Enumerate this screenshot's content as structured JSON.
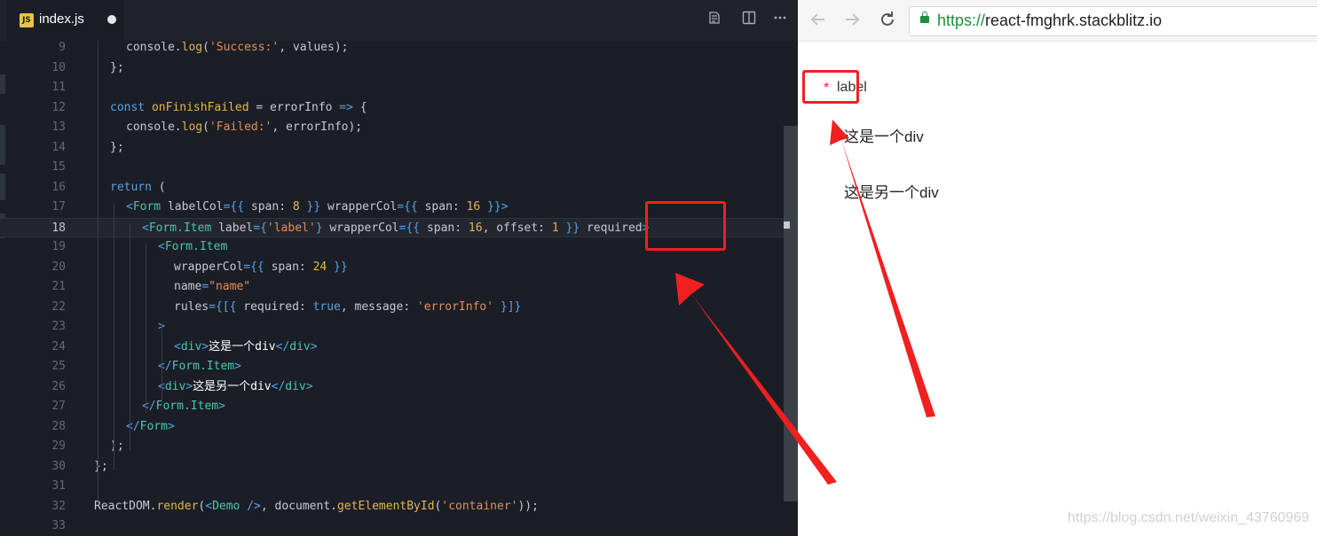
{
  "editor": {
    "tab": {
      "icon_text": "JS",
      "filename": "index.js"
    },
    "toolbar_icons": [
      "preview-icon",
      "split-editor-icon",
      "more-icon"
    ],
    "lines": [
      {
        "n": "9",
        "tokens": [
          [
            "attr",
            "console"
          ],
          [
            "attr",
            "."
          ],
          [
            "fn",
            "log"
          ],
          [
            "attr",
            "("
          ],
          [
            "str",
            "'Success:'"
          ],
          [
            "attr",
            ", values);"
          ]
        ]
      },
      {
        "n": "10",
        "tokens": [
          [
            "attr",
            "};"
          ]
        ]
      },
      {
        "n": "11",
        "tokens": []
      },
      {
        "n": "12",
        "tokens": [
          [
            "kw",
            "const "
          ],
          [
            "fn",
            "onFinishFailed"
          ],
          [
            "attr",
            " = errorInfo "
          ],
          [
            "kw",
            "=>"
          ],
          [
            "attr",
            " {"
          ]
        ]
      },
      {
        "n": "13",
        "tokens": [
          [
            "attr",
            "console"
          ],
          [
            "attr",
            "."
          ],
          [
            "fn",
            "log"
          ],
          [
            "attr",
            "("
          ],
          [
            "str",
            "'Failed:'"
          ],
          [
            "attr",
            ", errorInfo);"
          ]
        ]
      },
      {
        "n": "14",
        "tokens": [
          [
            "attr",
            "};"
          ]
        ]
      },
      {
        "n": "15",
        "tokens": []
      },
      {
        "n": "16",
        "tokens": [
          [
            "kw",
            "return"
          ],
          [
            "attr",
            " ("
          ]
        ]
      },
      {
        "n": "17",
        "tokens": [
          [
            "punc",
            "<"
          ],
          [
            "tag",
            "Form"
          ],
          [
            "attr",
            " labelCol"
          ],
          [
            "punc",
            "={{ "
          ],
          [
            "attr",
            "span: "
          ],
          [
            "num",
            "8"
          ],
          [
            "punc",
            " }}"
          ],
          [
            "attr",
            " wrapperCol"
          ],
          [
            "punc",
            "={{ "
          ],
          [
            "attr",
            "span: "
          ],
          [
            "num",
            "16"
          ],
          [
            "punc",
            " }}>"
          ]
        ]
      },
      {
        "n": "18",
        "tokens": [
          [
            "punc",
            "<"
          ],
          [
            "tag",
            "Form.Item"
          ],
          [
            "attr",
            " label"
          ],
          [
            "punc",
            "={"
          ],
          [
            "str",
            "'label'"
          ],
          [
            "punc",
            "}"
          ],
          [
            "attr",
            " wrapperCol"
          ],
          [
            "punc",
            "={{ "
          ],
          [
            "attr",
            "span: "
          ],
          [
            "num",
            "16"
          ],
          [
            "attr",
            ", offset: "
          ],
          [
            "num",
            "1"
          ],
          [
            "punc",
            " }}"
          ],
          [
            "attr",
            " required"
          ],
          [
            "punc",
            ">"
          ]
        ]
      },
      {
        "n": "19",
        "tokens": [
          [
            "punc",
            "<"
          ],
          [
            "tag",
            "Form.Item"
          ]
        ]
      },
      {
        "n": "20",
        "tokens": [
          [
            "attr",
            "wrapperCol"
          ],
          [
            "punc",
            "={{ "
          ],
          [
            "attr",
            "span: "
          ],
          [
            "num",
            "24"
          ],
          [
            "punc",
            " }}"
          ]
        ]
      },
      {
        "n": "21",
        "tokens": [
          [
            "attr",
            "name"
          ],
          [
            "punc",
            "="
          ],
          [
            "str",
            "\"name\""
          ]
        ]
      },
      {
        "n": "22",
        "tokens": [
          [
            "attr",
            "rules"
          ],
          [
            "punc",
            "={[{ "
          ],
          [
            "attr",
            "required: "
          ],
          [
            "kw",
            "true"
          ],
          [
            "attr",
            ", message: "
          ],
          [
            "str",
            "'errorInfo'"
          ],
          [
            "punc",
            " }]}"
          ]
        ]
      },
      {
        "n": "23",
        "tokens": [
          [
            "punc",
            ">"
          ]
        ]
      },
      {
        "n": "24",
        "tokens": [
          [
            "punc",
            "<"
          ],
          [
            "tag",
            "div"
          ],
          [
            "punc",
            ">"
          ],
          [
            "cn",
            "这是一个div"
          ],
          [
            "punc",
            "</"
          ],
          [
            "tag",
            "div"
          ],
          [
            "punc",
            ">"
          ]
        ]
      },
      {
        "n": "25",
        "tokens": [
          [
            "punc",
            "</"
          ],
          [
            "tag",
            "Form.Item"
          ],
          [
            "punc",
            ">"
          ]
        ]
      },
      {
        "n": "26",
        "tokens": [
          [
            "punc",
            "<"
          ],
          [
            "tag",
            "div"
          ],
          [
            "punc",
            ">"
          ],
          [
            "cn",
            "这是另一个div"
          ],
          [
            "punc",
            "</"
          ],
          [
            "tag",
            "div"
          ],
          [
            "punc",
            ">"
          ]
        ]
      },
      {
        "n": "27",
        "tokens": [
          [
            "punc",
            "</"
          ],
          [
            "tag",
            "Form.Item"
          ],
          [
            "punc",
            ">"
          ]
        ]
      },
      {
        "n": "28",
        "tokens": [
          [
            "punc",
            "</"
          ],
          [
            "tag",
            "Form"
          ],
          [
            "punc",
            ">"
          ]
        ]
      },
      {
        "n": "29",
        "tokens": [
          [
            "attr",
            ");"
          ]
        ]
      },
      {
        "n": "30",
        "tokens": [
          [
            "attr",
            "};"
          ]
        ]
      },
      {
        "n": "31",
        "tokens": []
      },
      {
        "n": "32",
        "tokens": [
          [
            "attr",
            "ReactDOM."
          ],
          [
            "fn",
            "render"
          ],
          [
            "attr",
            "("
          ],
          [
            "punc",
            "<"
          ],
          [
            "tag",
            "Demo"
          ],
          [
            "punc",
            " />"
          ],
          [
            "attr",
            ", document."
          ],
          [
            "fn",
            "getElementById"
          ],
          [
            "attr",
            "("
          ],
          [
            "str",
            "'container'"
          ],
          [
            "attr",
            "));"
          ]
        ]
      },
      {
        "n": "33",
        "tokens": []
      }
    ],
    "active_line": "18"
  },
  "browser": {
    "url_scheme": "https://",
    "url_host": "react-fmghrk.stackblitz.io",
    "nav_icons": [
      "back-arrow-icon",
      "forward-arrow-icon",
      "reload-icon",
      "lock-icon"
    ]
  },
  "page": {
    "required_mark": "*",
    "label": "label",
    "div_one": "这是一个div",
    "div_two": "这是另一个div",
    "watermark": "https://blog.csdn.net/weixin_43760969"
  },
  "colors": {
    "editor_bg": "#1b1e26",
    "annotation_red": "#f02020",
    "required_red": "#f5222d",
    "url_green": "#1e8e3e"
  }
}
